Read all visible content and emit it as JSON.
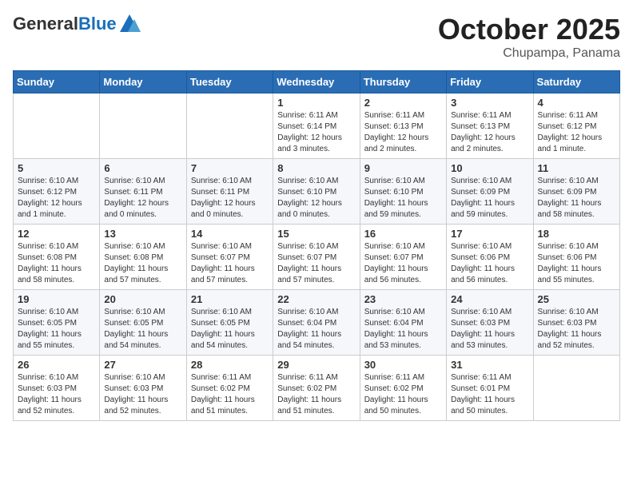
{
  "header": {
    "logo_general": "General",
    "logo_blue": "Blue",
    "month_title": "October 2025",
    "location": "Chupampa, Panama"
  },
  "weekdays": [
    "Sunday",
    "Monday",
    "Tuesday",
    "Wednesday",
    "Thursday",
    "Friday",
    "Saturday"
  ],
  "weeks": [
    [
      {
        "day": "",
        "info": ""
      },
      {
        "day": "",
        "info": ""
      },
      {
        "day": "",
        "info": ""
      },
      {
        "day": "1",
        "info": "Sunrise: 6:11 AM\nSunset: 6:14 PM\nDaylight: 12 hours and 3 minutes."
      },
      {
        "day": "2",
        "info": "Sunrise: 6:11 AM\nSunset: 6:13 PM\nDaylight: 12 hours and 2 minutes."
      },
      {
        "day": "3",
        "info": "Sunrise: 6:11 AM\nSunset: 6:13 PM\nDaylight: 12 hours and 2 minutes."
      },
      {
        "day": "4",
        "info": "Sunrise: 6:11 AM\nSunset: 6:12 PM\nDaylight: 12 hours and 1 minute."
      }
    ],
    [
      {
        "day": "5",
        "info": "Sunrise: 6:10 AM\nSunset: 6:12 PM\nDaylight: 12 hours and 1 minute."
      },
      {
        "day": "6",
        "info": "Sunrise: 6:10 AM\nSunset: 6:11 PM\nDaylight: 12 hours and 0 minutes."
      },
      {
        "day": "7",
        "info": "Sunrise: 6:10 AM\nSunset: 6:11 PM\nDaylight: 12 hours and 0 minutes."
      },
      {
        "day": "8",
        "info": "Sunrise: 6:10 AM\nSunset: 6:10 PM\nDaylight: 12 hours and 0 minutes."
      },
      {
        "day": "9",
        "info": "Sunrise: 6:10 AM\nSunset: 6:10 PM\nDaylight: 11 hours and 59 minutes."
      },
      {
        "day": "10",
        "info": "Sunrise: 6:10 AM\nSunset: 6:09 PM\nDaylight: 11 hours and 59 minutes."
      },
      {
        "day": "11",
        "info": "Sunrise: 6:10 AM\nSunset: 6:09 PM\nDaylight: 11 hours and 58 minutes."
      }
    ],
    [
      {
        "day": "12",
        "info": "Sunrise: 6:10 AM\nSunset: 6:08 PM\nDaylight: 11 hours and 58 minutes."
      },
      {
        "day": "13",
        "info": "Sunrise: 6:10 AM\nSunset: 6:08 PM\nDaylight: 11 hours and 57 minutes."
      },
      {
        "day": "14",
        "info": "Sunrise: 6:10 AM\nSunset: 6:07 PM\nDaylight: 11 hours and 57 minutes."
      },
      {
        "day": "15",
        "info": "Sunrise: 6:10 AM\nSunset: 6:07 PM\nDaylight: 11 hours and 57 minutes."
      },
      {
        "day": "16",
        "info": "Sunrise: 6:10 AM\nSunset: 6:07 PM\nDaylight: 11 hours and 56 minutes."
      },
      {
        "day": "17",
        "info": "Sunrise: 6:10 AM\nSunset: 6:06 PM\nDaylight: 11 hours and 56 minutes."
      },
      {
        "day": "18",
        "info": "Sunrise: 6:10 AM\nSunset: 6:06 PM\nDaylight: 11 hours and 55 minutes."
      }
    ],
    [
      {
        "day": "19",
        "info": "Sunrise: 6:10 AM\nSunset: 6:05 PM\nDaylight: 11 hours and 55 minutes."
      },
      {
        "day": "20",
        "info": "Sunrise: 6:10 AM\nSunset: 6:05 PM\nDaylight: 11 hours and 54 minutes."
      },
      {
        "day": "21",
        "info": "Sunrise: 6:10 AM\nSunset: 6:05 PM\nDaylight: 11 hours and 54 minutes."
      },
      {
        "day": "22",
        "info": "Sunrise: 6:10 AM\nSunset: 6:04 PM\nDaylight: 11 hours and 54 minutes."
      },
      {
        "day": "23",
        "info": "Sunrise: 6:10 AM\nSunset: 6:04 PM\nDaylight: 11 hours and 53 minutes."
      },
      {
        "day": "24",
        "info": "Sunrise: 6:10 AM\nSunset: 6:03 PM\nDaylight: 11 hours and 53 minutes."
      },
      {
        "day": "25",
        "info": "Sunrise: 6:10 AM\nSunset: 6:03 PM\nDaylight: 11 hours and 52 minutes."
      }
    ],
    [
      {
        "day": "26",
        "info": "Sunrise: 6:10 AM\nSunset: 6:03 PM\nDaylight: 11 hours and 52 minutes."
      },
      {
        "day": "27",
        "info": "Sunrise: 6:10 AM\nSunset: 6:03 PM\nDaylight: 11 hours and 52 minutes."
      },
      {
        "day": "28",
        "info": "Sunrise: 6:11 AM\nSunset: 6:02 PM\nDaylight: 11 hours and 51 minutes."
      },
      {
        "day": "29",
        "info": "Sunrise: 6:11 AM\nSunset: 6:02 PM\nDaylight: 11 hours and 51 minutes."
      },
      {
        "day": "30",
        "info": "Sunrise: 6:11 AM\nSunset: 6:02 PM\nDaylight: 11 hours and 50 minutes."
      },
      {
        "day": "31",
        "info": "Sunrise: 6:11 AM\nSunset: 6:01 PM\nDaylight: 11 hours and 50 minutes."
      },
      {
        "day": "",
        "info": ""
      }
    ]
  ]
}
